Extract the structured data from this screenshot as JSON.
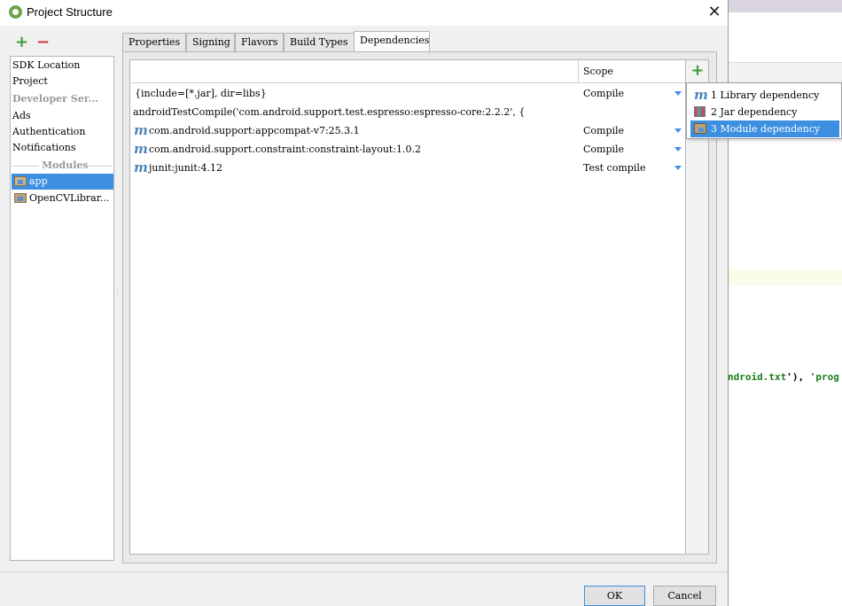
{
  "window": {
    "title": "Project Structure",
    "close_label": "✕"
  },
  "toolbar": {
    "add_label": "+",
    "remove_label": "−"
  },
  "sidebar": {
    "items": [
      "SDK Location",
      "Project",
      "Developer Ser...",
      "Ads",
      "Authentication",
      "Notifications"
    ],
    "modules_label": "Modules",
    "modules": [
      "app",
      "OpenCVLibrar..."
    ],
    "selected_module": "app"
  },
  "tabs": [
    "Properties",
    "Signing",
    "Flavors",
    "Build Types",
    "Dependencies"
  ],
  "active_tab": "Dependencies",
  "dependencies": {
    "scope_header": "Scope",
    "rows": [
      {
        "name": "{include=[*.jar], dir=libs}",
        "scope": "Compile",
        "icon": "none"
      },
      {
        "name": "androidTestCompile('com.android.support.test.espresso:espresso-core:2.2.2', {",
        "scope": "",
        "icon": "none"
      },
      {
        "name": "com.android.support:appcompat-v7:25.3.1",
        "scope": "Compile",
        "icon": "m-icon"
      },
      {
        "name": "com.android.support.constraint:constraint-layout:1.0.2",
        "scope": "Compile",
        "icon": "m-icon"
      },
      {
        "name": "junit:junit:4.12",
        "scope": "Test compile",
        "icon": "m-icon"
      }
    ],
    "add_label": "+"
  },
  "popup_menu": {
    "items": [
      {
        "label": "1  Library dependency",
        "icon": "m-icon"
      },
      {
        "label": "2  Jar dependency",
        "icon": "jar-icon"
      },
      {
        "label": "3  Module dependency",
        "icon": "module-folder-icon"
      }
    ],
    "selected_index": 2
  },
  "buttons": {
    "ok": "OK",
    "cancel": "Cancel"
  },
  "background_editor": {
    "code_green": "ndroid.txt",
    "code_dark": "'), ",
    "code_green2": "'prog"
  },
  "colors": {
    "selection": "#3d8fe2",
    "add_green": "#3a9b3a",
    "remove_red": "#d63a3a",
    "m_icon_blue": "#4f86bd"
  }
}
